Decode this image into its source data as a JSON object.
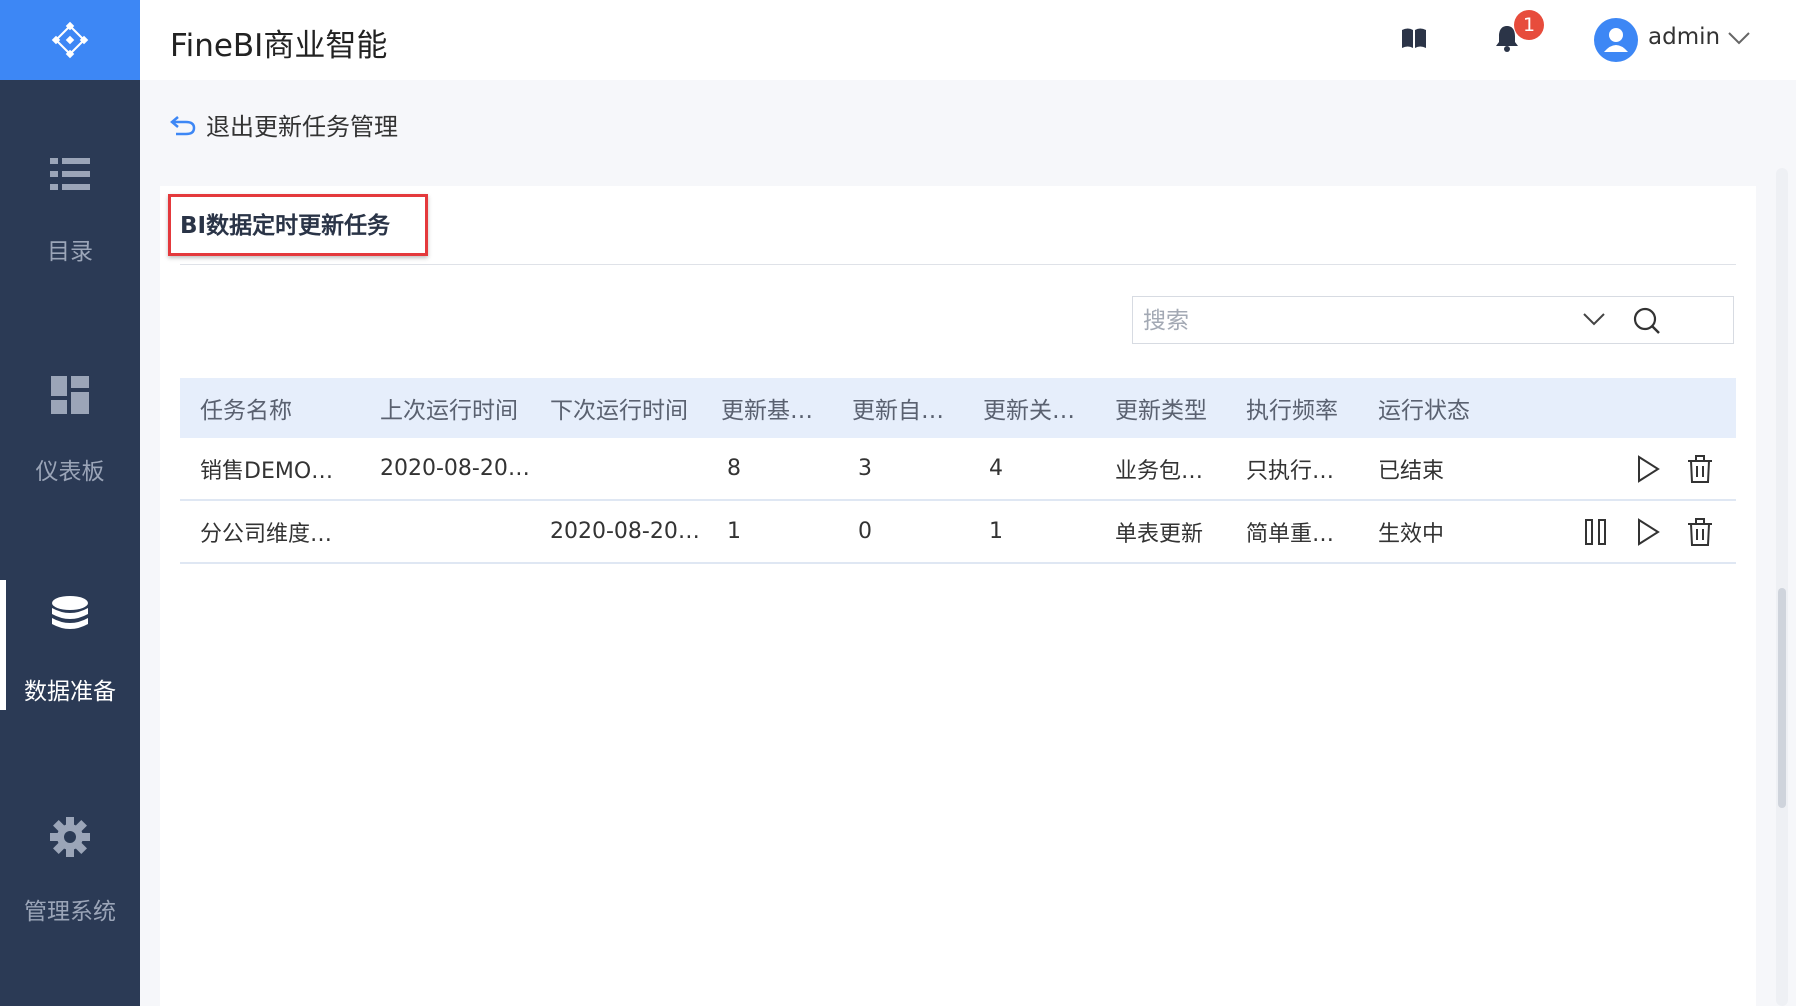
{
  "app": {
    "title": "FineBI商业智能"
  },
  "sidebar": {
    "items": [
      {
        "label": "目录",
        "icon": "list-icon",
        "active": false
      },
      {
        "label": "仪表板",
        "icon": "dashboard-icon",
        "active": false
      },
      {
        "label": "数据准备",
        "icon": "database-icon",
        "active": true
      },
      {
        "label": "管理系统",
        "icon": "gear-icon",
        "active": false
      }
    ]
  },
  "header": {
    "notification_count": "1",
    "username": "admin"
  },
  "back_link": {
    "label": "退出更新任务管理"
  },
  "panel": {
    "title": "BI数据定时更新任务",
    "search": {
      "placeholder": "搜索",
      "value": ""
    }
  },
  "table": {
    "columns": [
      "任务名称",
      "上次运行时间",
      "下次运行时间",
      "更新基…",
      "更新自…",
      "更新关…",
      "更新类型",
      "执行频率",
      "运行状态"
    ],
    "rows": [
      {
        "cells": [
          "销售DEMO…",
          "2020-08-20…",
          "",
          "8",
          "3",
          "4",
          "业务包…",
          "只执行…",
          "已结束"
        ],
        "actions": [
          "run",
          "delete"
        ]
      },
      {
        "cells": [
          "分公司维度…",
          "",
          "2020-08-20…",
          "1",
          "0",
          "1",
          "单表更新",
          "简单重…",
          "生效中"
        ],
        "actions": [
          "pause",
          "run",
          "delete"
        ]
      }
    ]
  },
  "colors": {
    "accent": "#3d87f5",
    "sidebar_bg": "#2b3a55",
    "highlight_border": "#e4393c",
    "table_header_bg": "#e6eefb",
    "badge": "#e74c3c"
  }
}
